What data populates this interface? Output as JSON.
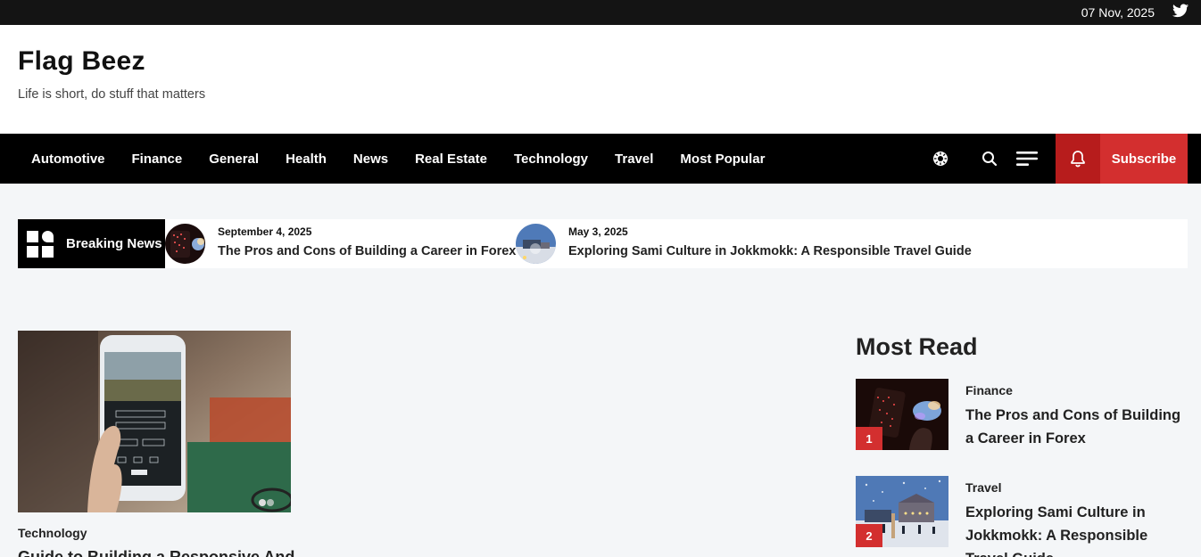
{
  "topbar": {
    "date": "07 Nov, 2025",
    "social_icon": "twitter-icon"
  },
  "site": {
    "title": "Flag Beez",
    "tagline": "Life is short, do stuff that matters"
  },
  "nav": {
    "items": [
      "Automotive",
      "Finance",
      "General",
      "Health",
      "News",
      "Real Estate",
      "Technology",
      "Travel",
      "Most Popular"
    ],
    "icons": [
      "theme-toggle-icon",
      "search-icon",
      "menu-icon",
      "bell-icon"
    ],
    "subscribe_label": "Subscribe"
  },
  "breaking": {
    "label": "Breaking News",
    "items": [
      {
        "date": "September 4, 2025",
        "title": "The Pros and Cons of Building a Career in Forex"
      },
      {
        "date": "May 3, 2025",
        "title": "Exploring Sami Culture in Jokkmokk: A Responsible Travel Guide"
      }
    ]
  },
  "featured": {
    "category": "Technology",
    "title": "Guide to Building a Responsive And"
  },
  "most_read": {
    "heading": "Most Read",
    "items": [
      {
        "num": "1",
        "category": "Finance",
        "title": "The Pros and Cons of Building a Career in Forex"
      },
      {
        "num": "2",
        "category": "Travel",
        "title": "Exploring Sami Culture in Jokkmokk: A Responsible Travel Guide"
      }
    ]
  },
  "colors": {
    "accent": "#d32f2f",
    "accent_dark": "#b71c1c",
    "nav_bg": "#000000",
    "topbar_bg": "#141414",
    "page_bg": "#f4f6f8"
  }
}
